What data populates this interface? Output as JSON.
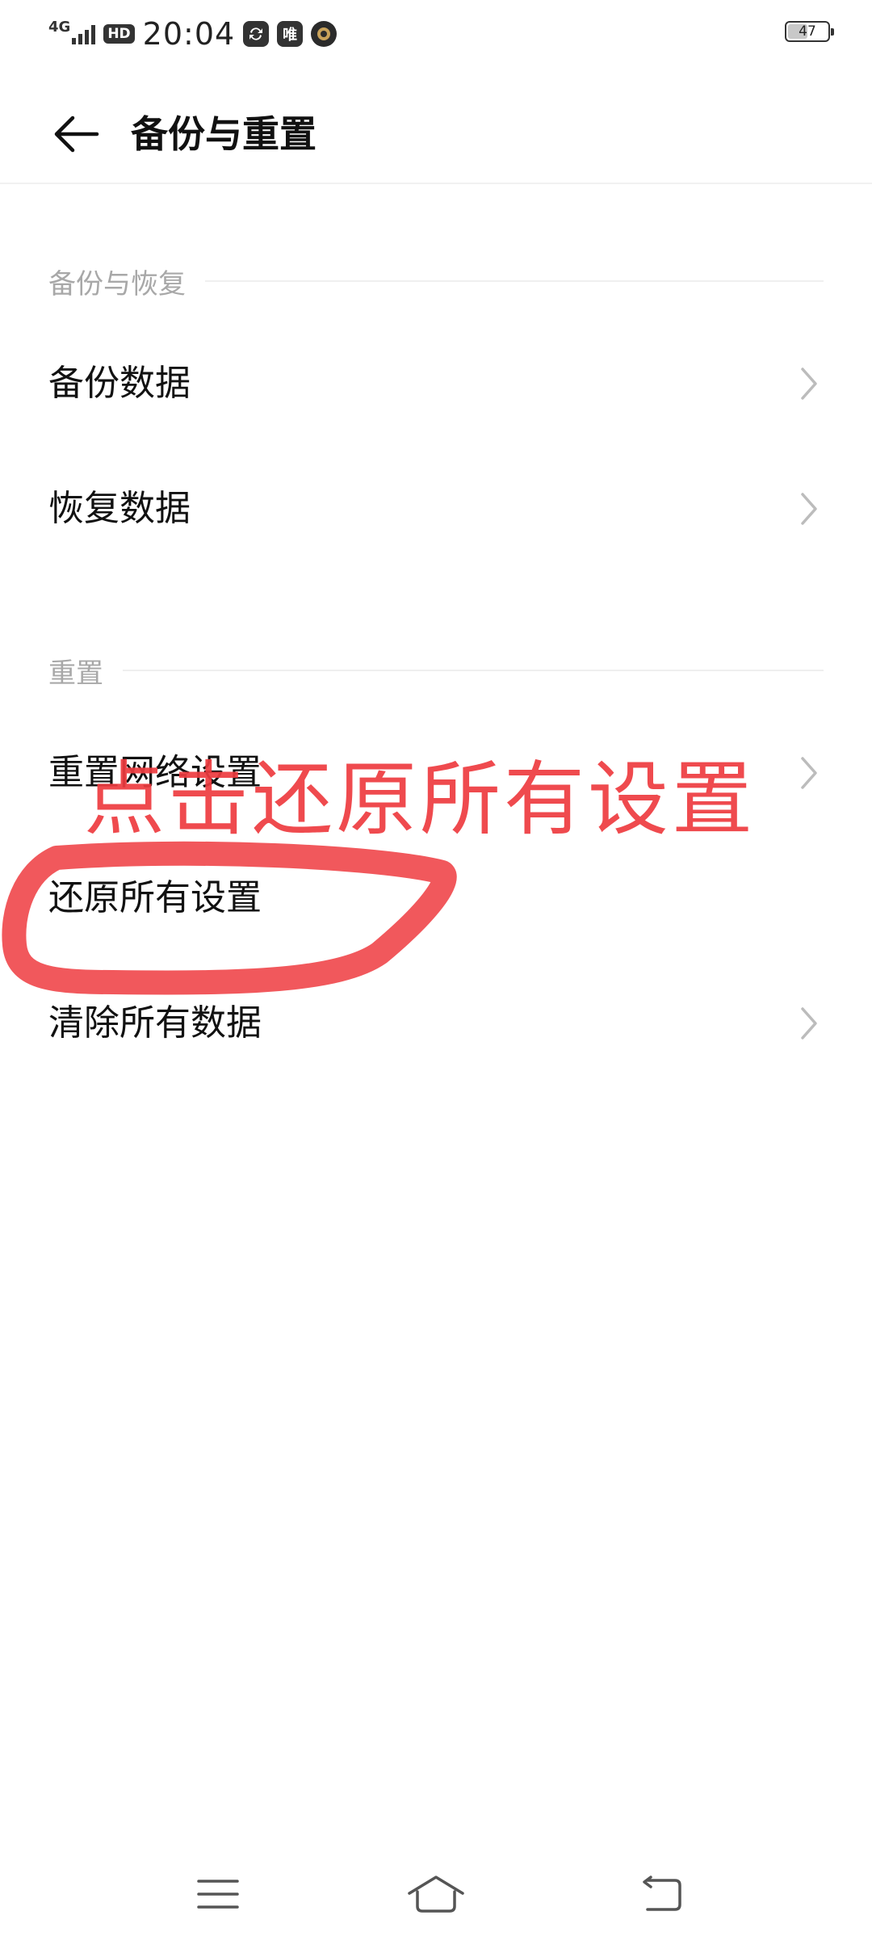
{
  "status_bar": {
    "network": "4G",
    "hd_badge": "HD",
    "time": "20:04",
    "app_icon_1": "sync-icon",
    "app_icon_2_text": "唯",
    "app_icon_3": "shield-app-icon",
    "battery_percent": "47",
    "battery_level": 0.47
  },
  "header": {
    "title": "备份与重置",
    "back_icon": "back-arrow-icon"
  },
  "sections": {
    "backup": {
      "label": "备份与恢复",
      "items": [
        {
          "label": "备份数据"
        },
        {
          "label": "恢复数据"
        }
      ]
    },
    "reset": {
      "label": "重置",
      "items": [
        {
          "label": "重置网络设置"
        },
        {
          "label": "还原所有设置"
        },
        {
          "label": "清除所有数据"
        }
      ]
    }
  },
  "annotation": {
    "text": "点击还原所有设置",
    "color": "#ee3b3f"
  },
  "nav_bar": {
    "menu_icon": "menu-icon",
    "home_icon": "home-icon",
    "back_icon": "back-icon"
  }
}
